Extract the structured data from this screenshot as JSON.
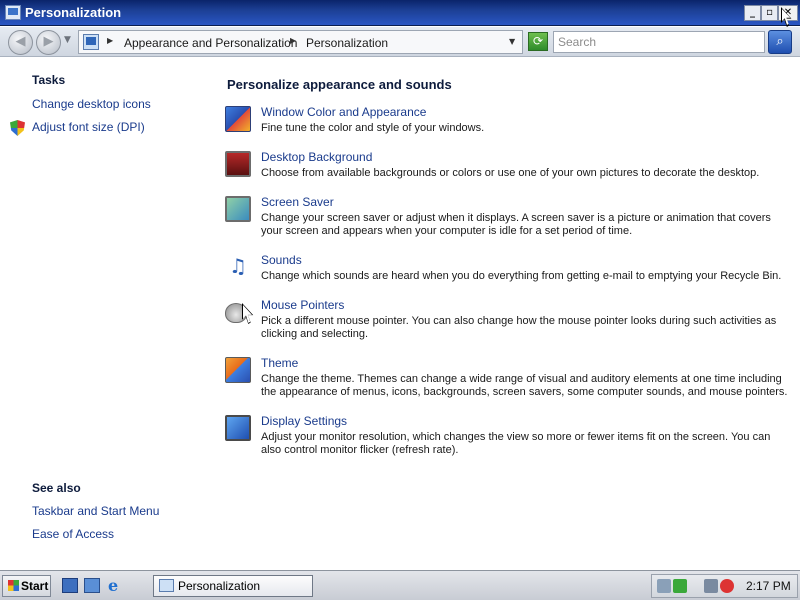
{
  "window": {
    "title": "Personalization",
    "controls": {
      "minimize": "_",
      "maximize": "▫",
      "close": "✕"
    }
  },
  "address_bar": {
    "breadcrumbs": [
      "Appearance and Personalization",
      "Personalization"
    ],
    "search_placeholder": "Search"
  },
  "tasks": {
    "heading": "Tasks",
    "links": [
      "Change desktop icons",
      "Adjust font size (DPI)"
    ]
  },
  "see_also": {
    "heading": "See also",
    "links": [
      "Taskbar and Start Menu",
      "Ease of Access"
    ]
  },
  "main": {
    "heading": "Personalize appearance and sounds",
    "items": [
      {
        "title": "Window Color and Appearance",
        "description": "Fine tune the color and style of your windows.",
        "icon": "window-color-icon"
      },
      {
        "title": "Desktop Background",
        "description": "Choose from available backgrounds or colors or use one of your own pictures to decorate the desktop.",
        "icon": "desktop-background-icon"
      },
      {
        "title": "Screen Saver",
        "description": "Change your screen saver or adjust when it displays. A screen saver is a picture or animation that covers your screen and appears when your computer is idle for a set period of time.",
        "icon": "screen-saver-icon"
      },
      {
        "title": "Sounds",
        "description": "Change which sounds are heard when you do everything from getting e-mail to emptying your Recycle Bin.",
        "icon": "sounds-icon"
      },
      {
        "title": "Mouse Pointers",
        "description": "Pick a different mouse pointer. You can also change how the mouse pointer looks during such activities as clicking and selecting.",
        "icon": "mouse-pointers-icon"
      },
      {
        "title": "Theme",
        "description": "Change the theme. Themes can change a wide range of visual and auditory elements at one time including the appearance of menus, icons, backgrounds, screen savers, some computer sounds, and mouse pointers.",
        "icon": "theme-icon"
      },
      {
        "title": "Display Settings",
        "description": "Adjust your monitor resolution, which changes the view so more or fewer items fit on the screen. You can also control monitor flicker (refresh rate).",
        "icon": "display-settings-icon"
      }
    ]
  },
  "taskbar": {
    "start_label": "Start",
    "open_window": "Personalization",
    "clock": "2:17 PM"
  }
}
